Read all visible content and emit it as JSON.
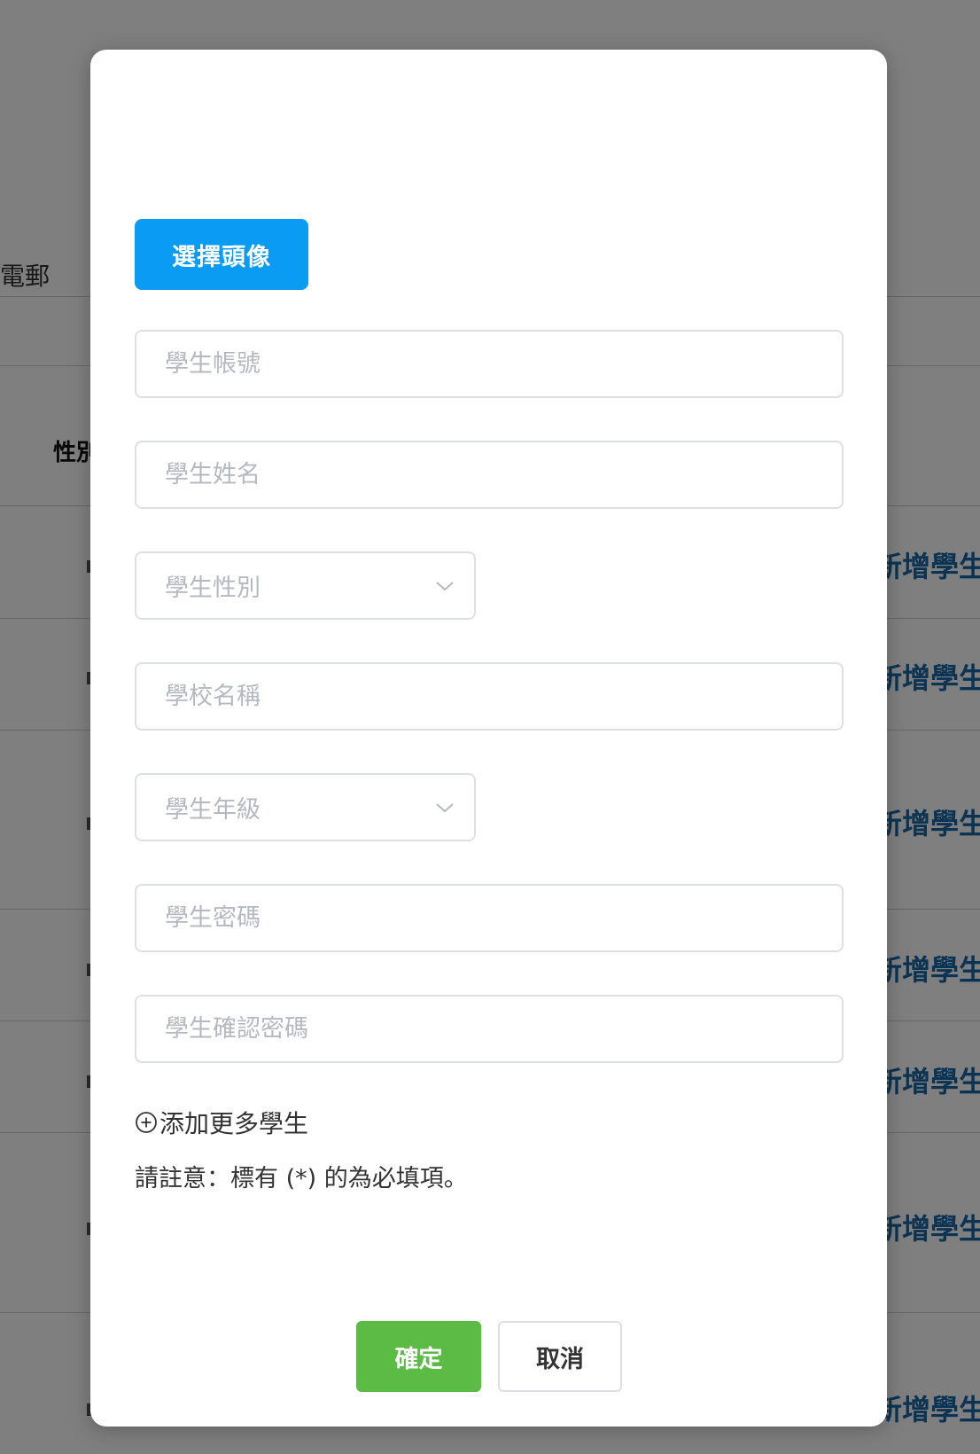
{
  "background": {
    "header_label": "電郵",
    "gender_label": "性別",
    "row_link_label": "新增學生",
    "row_links": [
      "新增學生",
      "新增學生",
      "新增學生",
      "新增學生",
      "新增學生",
      "新增學生",
      "新增學生"
    ]
  },
  "modal": {
    "avatar_button_label": "選擇頭像",
    "fields": {
      "account_placeholder": "學生帳號",
      "name_placeholder": "學生姓名",
      "gender_placeholder": "學生性別",
      "school_placeholder": "學校名稱",
      "grade_placeholder": "學生年級",
      "password_placeholder": "學生密碼",
      "confirm_password_placeholder": "學生確認密碼"
    },
    "add_more_label": "添加更多學生",
    "note_text": "請註意：標有 (*) 的為必填項。",
    "confirm_label": "確定",
    "cancel_label": "取消"
  },
  "colors": {
    "primary_blue": "#0a9cf5",
    "confirm_green": "#5bbb45",
    "link_blue": "#1768a8",
    "overlay": "rgba(0,0,0,0.5)"
  }
}
